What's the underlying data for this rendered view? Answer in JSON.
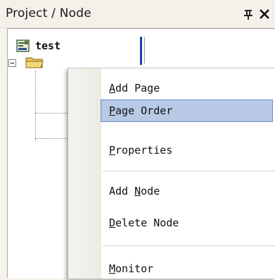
{
  "panel": {
    "title": "Project / Node",
    "pin_glyph": " ",
    "close_glyph": "✕"
  },
  "tree": {
    "root_label": "test"
  },
  "context_menu": {
    "items": [
      {
        "label": "Add Page",
        "mnemonic": "A",
        "selected": false
      },
      {
        "label": "Page Order",
        "mnemonic": "P",
        "selected": true
      },
      {
        "label": "Properties",
        "mnemonic": "P",
        "selected": false
      },
      {
        "label": "Add Node",
        "mnemonic": "N",
        "selected": false
      },
      {
        "label": "Delete Node",
        "mnemonic": "D",
        "selected": false
      },
      {
        "label": "Monitor",
        "mnemonic": "M",
        "selected": false
      }
    ]
  },
  "colors": {
    "highlight": "#b8c9e6",
    "highlight_border": "#6b8cc4",
    "caret": "#1f3fae"
  },
  "icons": {
    "root": "project-icon",
    "folder": "folder-icon",
    "pin": "pin-icon",
    "close": "close-icon"
  }
}
